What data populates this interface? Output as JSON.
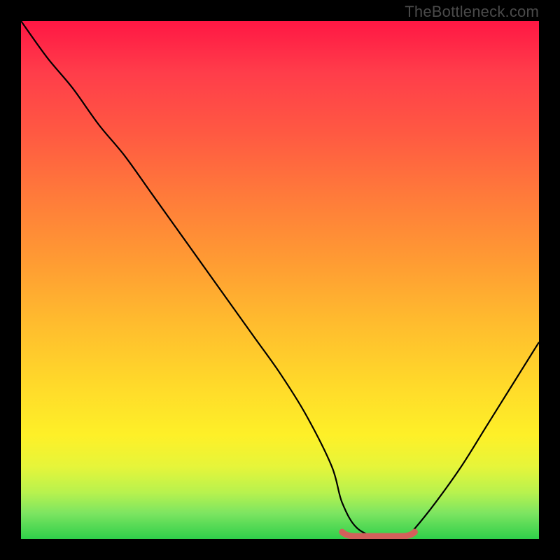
{
  "watermark": "TheBottleneck.com",
  "colors": {
    "gradient_top": "#ff1744",
    "gradient_bottom": "#2fcf4a",
    "curve": "#000000",
    "flat_segment": "#d4605b",
    "frame": "#000000"
  },
  "chart_data": {
    "type": "line",
    "title": "",
    "xlabel": "",
    "ylabel": "",
    "xlim": [
      0,
      100
    ],
    "ylim": [
      0,
      100
    ],
    "grid": false,
    "legend": false,
    "series": [
      {
        "name": "bottleneck-curve",
        "x": [
          0,
          5,
          10,
          15,
          20,
          25,
          30,
          35,
          40,
          45,
          50,
          55,
          60,
          62,
          65,
          70,
          74,
          76,
          80,
          85,
          90,
          95,
          100
        ],
        "y": [
          100,
          93,
          87,
          80,
          74,
          67,
          60,
          53,
          46,
          39,
          32,
          24,
          14,
          7,
          2,
          0,
          0,
          2,
          7,
          14,
          22,
          30,
          38
        ]
      }
    ],
    "annotations": [
      {
        "name": "optimal-flat-range",
        "x_start": 62,
        "x_end": 76,
        "y": 0
      }
    ]
  }
}
